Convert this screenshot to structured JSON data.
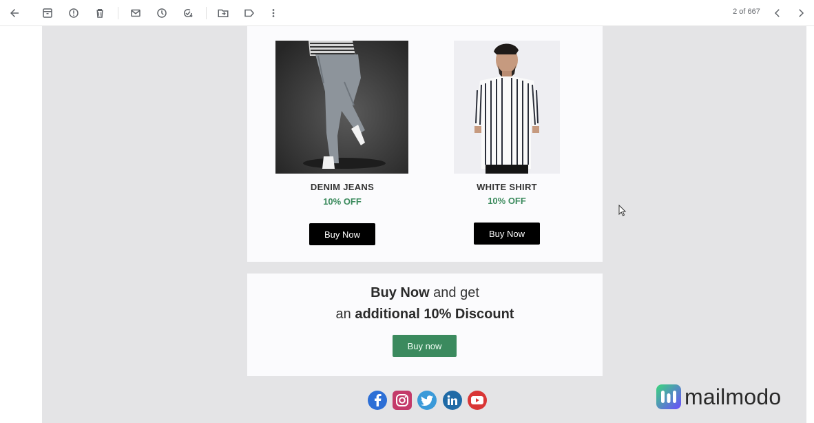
{
  "toolbar": {
    "icons": [
      "back-arrow-icon",
      "archive-icon",
      "report-spam-icon",
      "delete-icon",
      "mark-unread-icon",
      "snooze-icon",
      "add-task-icon",
      "move-to-icon",
      "label-icon",
      "more-vert-icon"
    ],
    "pager": "2 of 667"
  },
  "products": [
    {
      "name": "DENIM JEANS",
      "discount": "10% OFF",
      "button": "Buy Now"
    },
    {
      "name": "WHITE SHIRT",
      "discount": "10% OFF",
      "button": "Buy Now"
    }
  ],
  "promo": {
    "line1_bold": "Buy Now",
    "line1_rest": " and get",
    "line2_start": "an ",
    "line2_bold": "additional 10% Discount",
    "button": "Buy now"
  },
  "social": [
    "facebook-icon",
    "instagram-icon",
    "twitter-icon",
    "linkedin-icon",
    "youtube-icon"
  ],
  "brand": {
    "name": "mailmodo"
  },
  "colors": {
    "accent_green": "#3b8a5e",
    "discount_green": "#3a8a5c",
    "brand_gradient_start": "#3ad67c",
    "brand_gradient_end": "#6b4bff"
  }
}
